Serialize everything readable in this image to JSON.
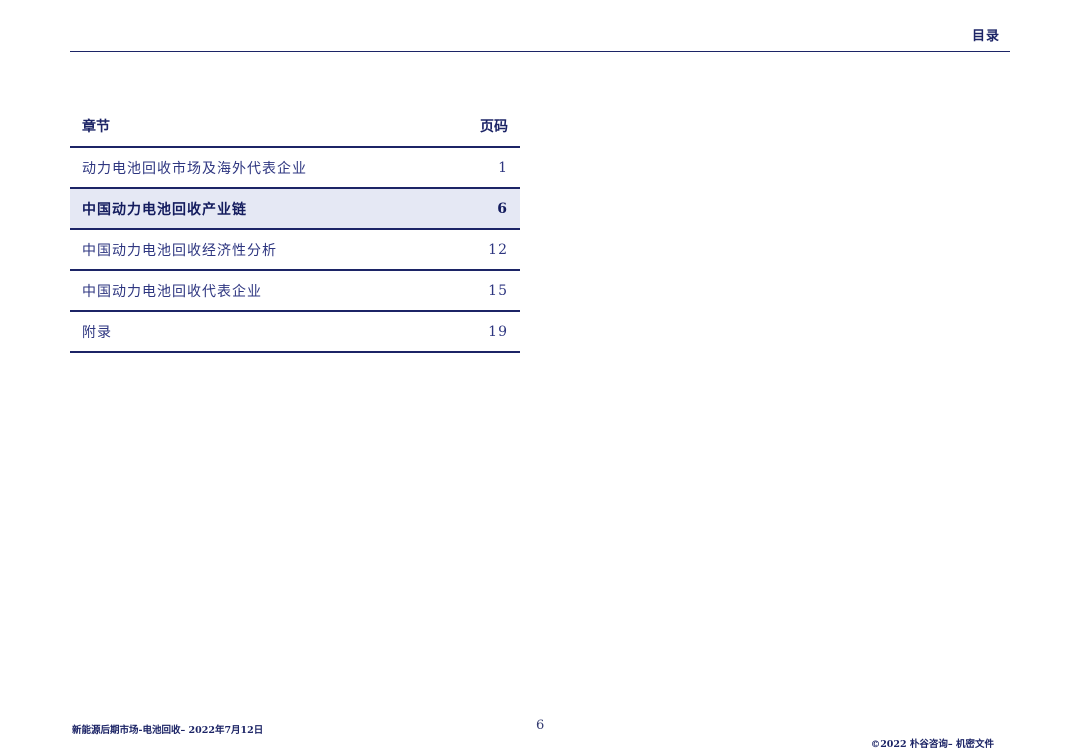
{
  "header": {
    "section_label": "目录"
  },
  "toc": {
    "col_chapter": "章节",
    "col_page": "页码",
    "rows": [
      {
        "title": "动力电池回收市场及海外代表企业",
        "page": "1"
      },
      {
        "title": "中国动力电池回收产业链",
        "page": "6"
      },
      {
        "title": "中国动力电池回收经济性分析",
        "page": "12"
      },
      {
        "title": "中国动力电池回收代表企业",
        "page": "15"
      },
      {
        "title": "附录",
        "page": "19"
      }
    ]
  },
  "footer": {
    "left": "新能源后期市场-电池回收– 2022年7月12日",
    "page_number": "6",
    "right": "©2022 朴谷咨询– 机密文件"
  }
}
